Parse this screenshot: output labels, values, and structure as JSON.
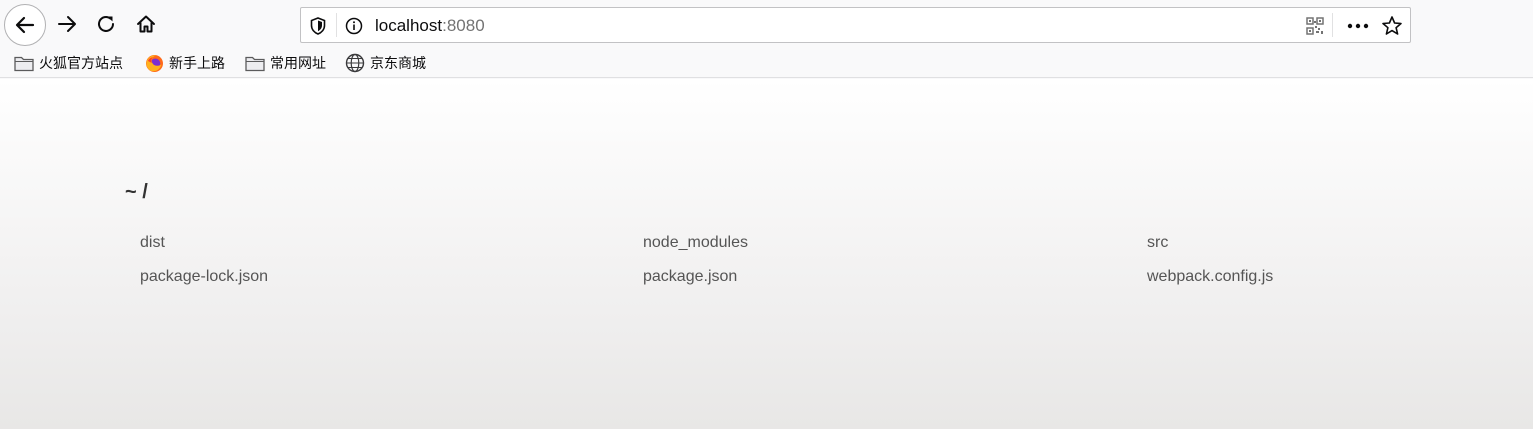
{
  "browser": {
    "url_host": "localhost",
    "url_port": ":8080"
  },
  "bookmarks": [
    {
      "label": "火狐官方站点",
      "icon": "folder-icon"
    },
    {
      "label": "新手上路",
      "icon": "firefox-icon"
    },
    {
      "label": "常用网址",
      "icon": "folder-icon"
    },
    {
      "label": "京东商城",
      "icon": "globe-icon"
    }
  ],
  "listing": {
    "path": "~ /",
    "files": [
      "dist",
      "node_modules",
      "src",
      "package-lock.json",
      "package.json",
      "webpack.config.js"
    ]
  }
}
